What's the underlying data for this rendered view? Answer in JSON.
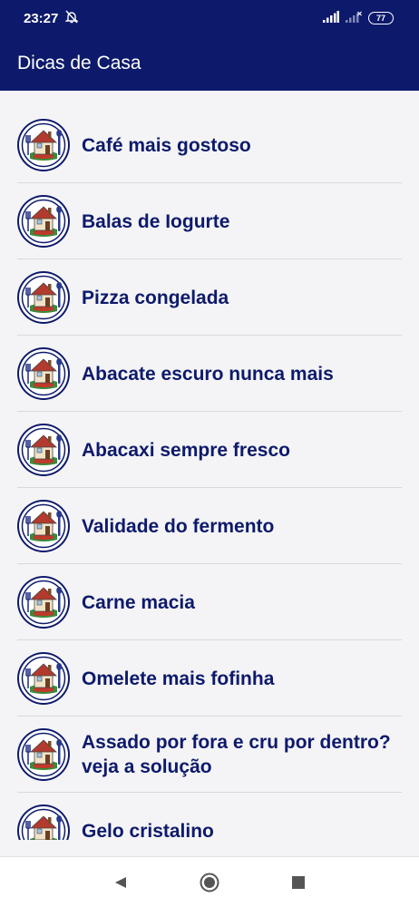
{
  "status": {
    "time": "23:27",
    "battery": "77"
  },
  "app_bar": {
    "title": "Dicas de Casa"
  },
  "tips": [
    {
      "title": "Café mais gostoso"
    },
    {
      "title": "Balas de Iogurte"
    },
    {
      "title": "Pizza congelada"
    },
    {
      "title": "Abacate escuro nunca mais"
    },
    {
      "title": "Abacaxi sempre fresco"
    },
    {
      "title": "Validade do fermento"
    },
    {
      "title": "Carne macia"
    },
    {
      "title": "Omelete mais fofinha"
    },
    {
      "title": "Assado por fora e cru por dentro? veja a solução"
    },
    {
      "title": "Gelo cristalino"
    }
  ],
  "icons": {
    "tip_avatar": "house-with-kitchen-utensils-icon",
    "mute": "bell-off-icon",
    "signal": "cell-signal-icon",
    "nav_back": "triangle-back-icon",
    "nav_home": "circle-home-icon",
    "nav_recents": "square-recents-icon"
  },
  "colors": {
    "primary": "#0d1a6b",
    "background": "#f4f4f6"
  }
}
